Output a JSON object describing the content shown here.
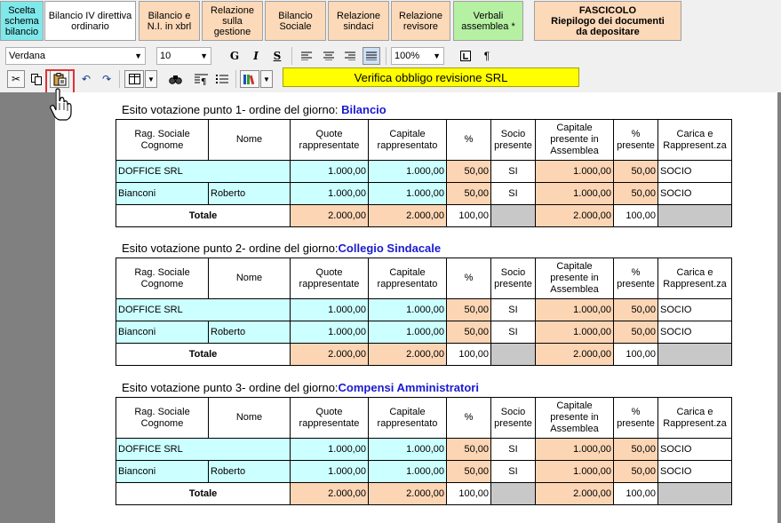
{
  "tabs": [
    {
      "label": "Scelta\nschema\nbilancio",
      "style": "cyan"
    },
    {
      "label": "Bilancio IV direttiva\nordinario",
      "style": "white"
    },
    {
      "label": "Bilancio e\nN.I. in xbrl",
      "style": "peach"
    },
    {
      "label": "Relazione\nsulla\ngestione",
      "style": "peach"
    },
    {
      "label": "Bilancio\nSociale",
      "style": "peach"
    },
    {
      "label": "Relazione\nsindaci",
      "style": "peach"
    },
    {
      "label": "Relazione\nrevisore",
      "style": "peach"
    },
    {
      "label": "Verbali\nassemblea *",
      "style": "green"
    },
    {
      "label": "FASCICOLO\nRiepilogo dei documenti\nda depositare",
      "style": "fascicolo"
    }
  ],
  "toolbar": {
    "font": "Verdana",
    "size": "10",
    "zoom": "100%",
    "bold": "G",
    "italic": "I",
    "underline": "S",
    "pilcrow": "¶",
    "verify_label": "Verifica obbligo revisione SRL"
  },
  "table_headers": [
    "Rag. Sociale\nCognome",
    "Nome",
    "Quote\nrappresentate",
    "Capitale\nrappresentato",
    "%",
    "Socio\npresente",
    "Capitale\npresente in\nAssemblea",
    "%\npresente",
    "Carica e\nRappresent.za"
  ],
  "sections": [
    {
      "prefix": "Esito votazione punto 1- ordine del giorno: ",
      "topic": "Bilancio",
      "rows": [
        {
          "rag": "DOFFICE SRL",
          "nome": "",
          "quote": "1.000,00",
          "capitale": "1.000,00",
          "perc": "50,00",
          "socio": "SI",
          "cap_pres": "1.000,00",
          "perc_pres": "50,00",
          "carica": "SOCIO"
        },
        {
          "rag": "Bianconi",
          "nome": "Roberto",
          "quote": "1.000,00",
          "capitale": "1.000,00",
          "perc": "50,00",
          "socio": "SI",
          "cap_pres": "1.000,00",
          "perc_pres": "50,00",
          "carica": "SOCIO"
        }
      ],
      "total": {
        "label": "Totale",
        "quote": "2.000,00",
        "capitale": "2.000,00",
        "perc": "100,00",
        "cap_pres": "2.000,00",
        "perc_pres": "100,00"
      }
    },
    {
      "prefix": "Esito votazione punto 2- ordine del giorno:",
      "topic": "Collegio Sindacale",
      "rows": [
        {
          "rag": "DOFFICE SRL",
          "nome": "",
          "quote": "1.000,00",
          "capitale": "1.000,00",
          "perc": "50,00",
          "socio": "SI",
          "cap_pres": "1.000,00",
          "perc_pres": "50,00",
          "carica": "SOCIO"
        },
        {
          "rag": "Bianconi",
          "nome": "Roberto",
          "quote": "1.000,00",
          "capitale": "1.000,00",
          "perc": "50,00",
          "socio": "SI",
          "cap_pres": "1.000,00",
          "perc_pres": "50,00",
          "carica": "SOCIO"
        }
      ],
      "total": {
        "label": "Totale",
        "quote": "2.000,00",
        "capitale": "2.000,00",
        "perc": "100,00",
        "cap_pres": "2.000,00",
        "perc_pres": "100,00"
      }
    },
    {
      "prefix": "Esito votazione punto 3- ordine del giorno:",
      "topic": "Compensi Amministratori",
      "rows": [
        {
          "rag": "DOFFICE SRL",
          "nome": "",
          "quote": "1.000,00",
          "capitale": "1.000,00",
          "perc": "50,00",
          "socio": "SI",
          "cap_pres": "1.000,00",
          "perc_pres": "50,00",
          "carica": "SOCIO"
        },
        {
          "rag": "Bianconi",
          "nome": "Roberto",
          "quote": "1.000,00",
          "capitale": "1.000,00",
          "perc": "50,00",
          "socio": "SI",
          "cap_pres": "1.000,00",
          "perc_pres": "50,00",
          "carica": "SOCIO"
        }
      ],
      "total": {
        "label": "Totale",
        "quote": "2.000,00",
        "capitale": "2.000,00",
        "perc": "100,00",
        "cap_pres": "2.000,00",
        "perc_pres": "100,00"
      }
    }
  ],
  "icons": [
    "cut-icon",
    "copy-icon",
    "paste-icon",
    "undo-icon",
    "redo-icon",
    "table-icon",
    "find-icon",
    "paragraph-icon",
    "list-icon",
    "books-icon",
    "page-icon",
    "hand-cursor-icon"
  ]
}
